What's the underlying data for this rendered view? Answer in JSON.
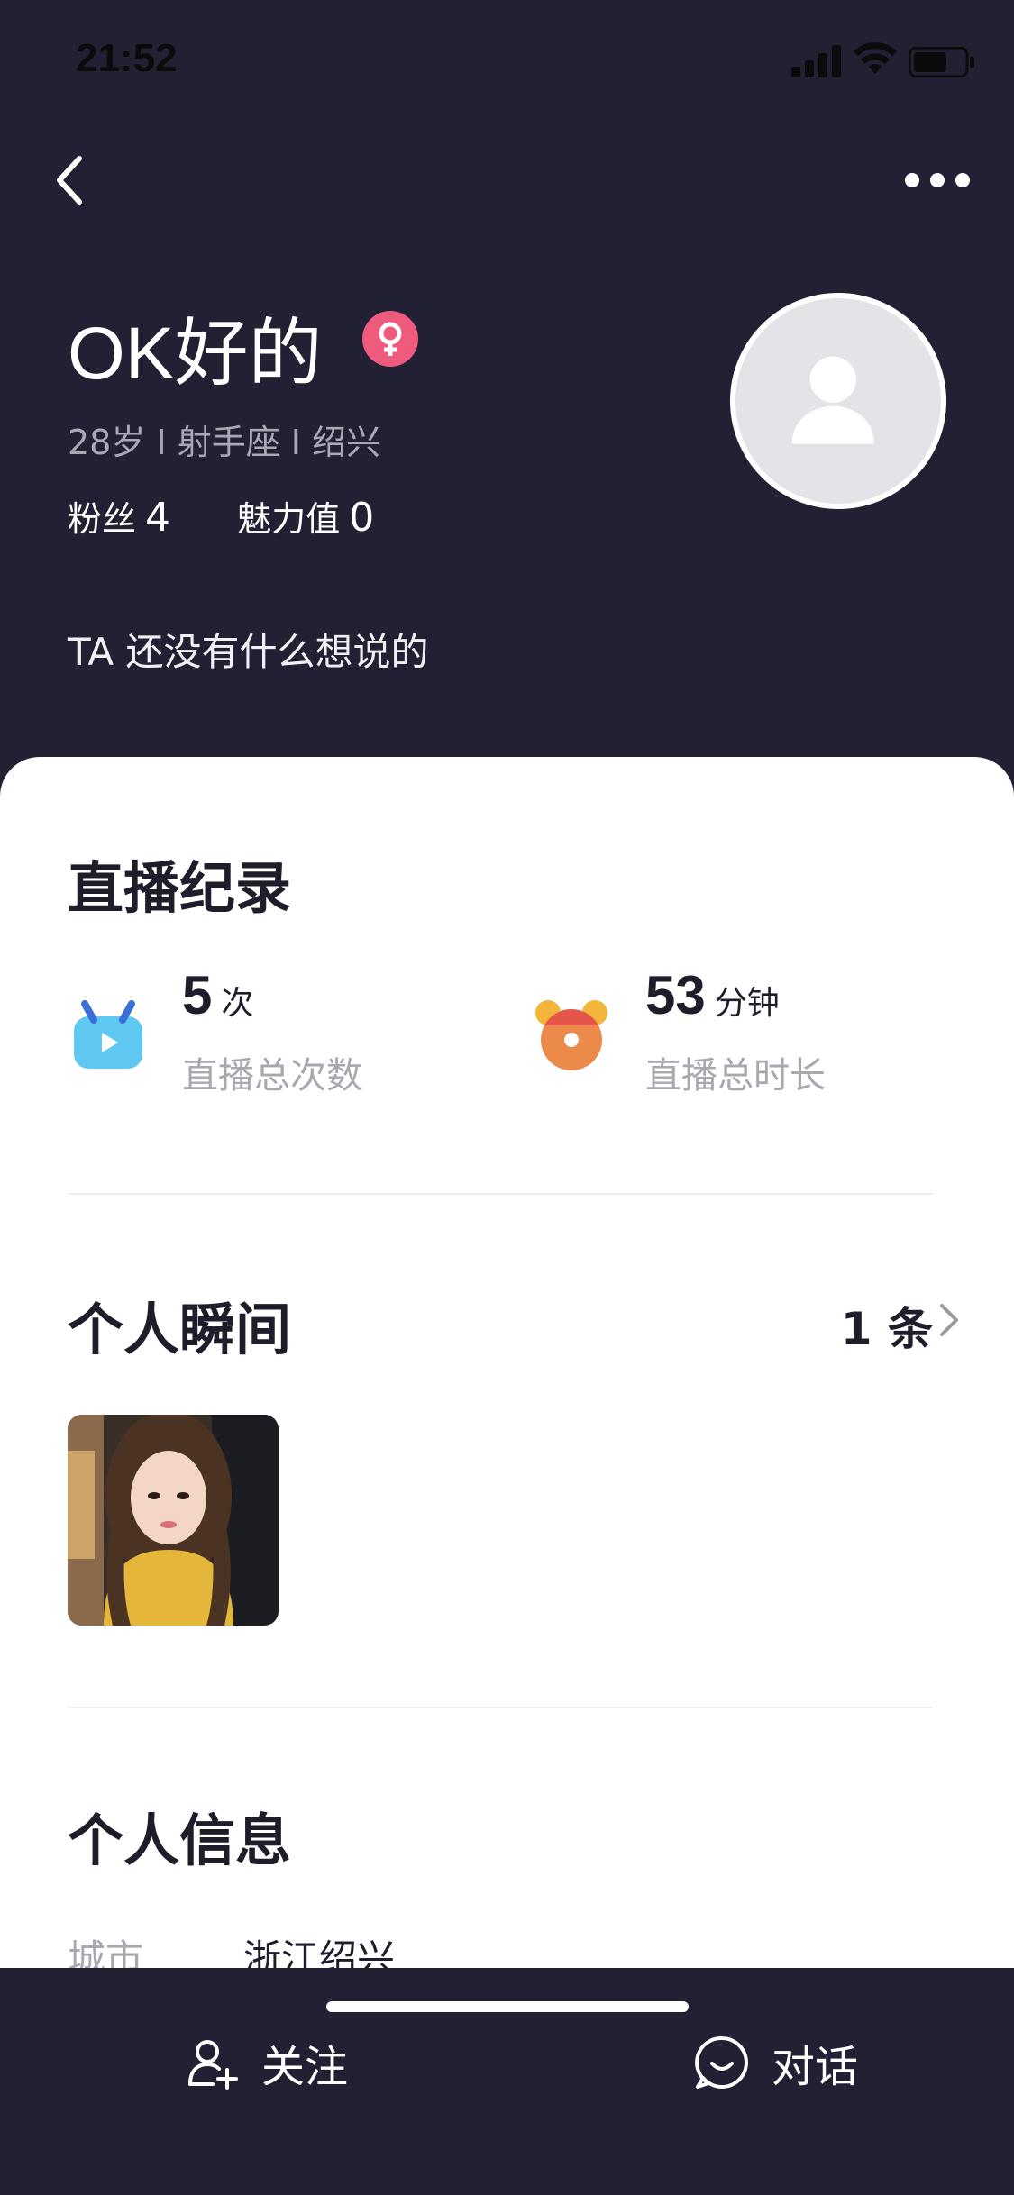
{
  "status": {
    "time": "21:52"
  },
  "profile": {
    "name": "OK好的",
    "meta": "28岁 I 射手座 I 绍兴",
    "fans_label": "粉丝",
    "fans_count": "4",
    "charm_label": "魅力值",
    "charm_value": "0",
    "bio": "TA 还没有什么想说的"
  },
  "live_record": {
    "title": "直播纪录",
    "total_count": "5",
    "count_unit": "次",
    "count_label": "直播总次数",
    "total_minutes": "53",
    "minutes_unit": "分钟",
    "minutes_label": "直播总时长"
  },
  "moments": {
    "title": "个人瞬间",
    "count": "1 条"
  },
  "personal_info": {
    "title": "个人信息",
    "city_key": "城市",
    "city_value": "浙江绍兴"
  },
  "actions": {
    "follow_label": "关注",
    "chat_label": "对话"
  },
  "colors": {
    "header_bg": "#222033",
    "gender_badge": "#ef5b7d",
    "live_icon": "#5ec8f2",
    "clock_icon": "#ec8a4c"
  }
}
